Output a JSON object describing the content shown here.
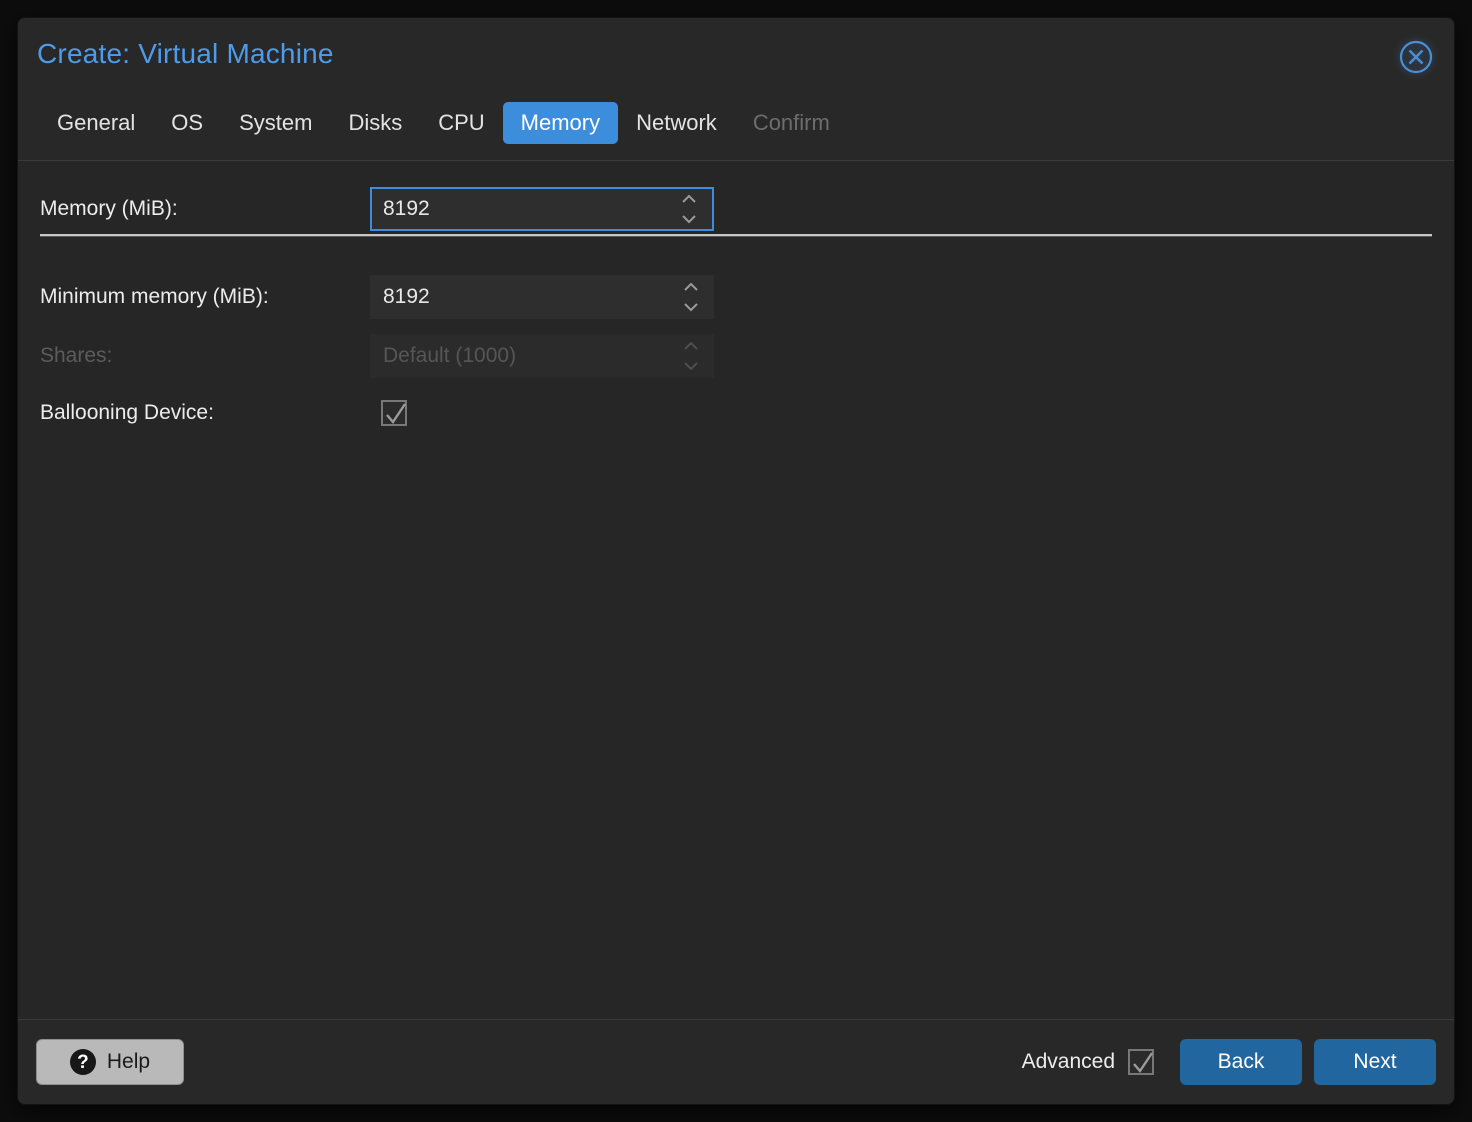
{
  "window": {
    "title": "Create: Virtual Machine",
    "close_icon": "close-circle-icon",
    "accent_color": "#3c8ddc",
    "title_color": "#4e9bea",
    "button_blue": "#22669f"
  },
  "tabs": [
    {
      "label": "General",
      "state": "normal"
    },
    {
      "label": "OS",
      "state": "normal"
    },
    {
      "label": "System",
      "state": "normal"
    },
    {
      "label": "Disks",
      "state": "normal"
    },
    {
      "label": "CPU",
      "state": "normal"
    },
    {
      "label": "Memory",
      "state": "active"
    },
    {
      "label": "Network",
      "state": "normal"
    },
    {
      "label": "Confirm",
      "state": "disabled"
    }
  ],
  "form": {
    "memory": {
      "label": "Memory (MiB):",
      "value": "8192",
      "placeholder": "",
      "focused": true,
      "disabled": false,
      "spinner_icon": "spinner-arrows-icon"
    },
    "minimum_memory": {
      "label": "Minimum memory (MiB):",
      "value": "8192",
      "placeholder": "",
      "focused": false,
      "disabled": false,
      "spinner_icon": "spinner-arrows-icon"
    },
    "shares": {
      "label": "Shares:",
      "value": "",
      "placeholder": "Default (1000)",
      "focused": false,
      "disabled": true,
      "spinner_icon": "spinner-arrows-icon"
    },
    "ballooning_device": {
      "label": "Ballooning Device:",
      "checked": true,
      "checkbox_icon": "checkbox-checked-icon"
    }
  },
  "footer": {
    "help_label": "Help",
    "help_icon": "question-circle-icon",
    "advanced_label": "Advanced",
    "advanced_checked": true,
    "advanced_checkbox_icon": "checkbox-checked-icon",
    "back_label": "Back",
    "next_label": "Next"
  }
}
